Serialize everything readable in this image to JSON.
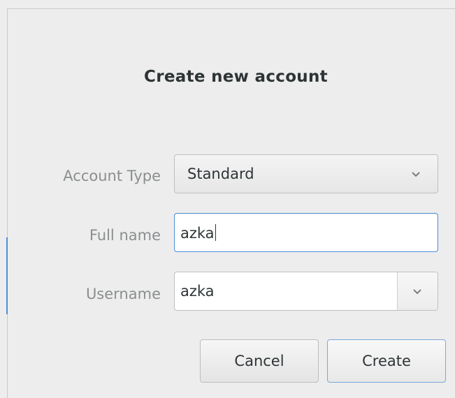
{
  "dialog": {
    "title": "Create new account"
  },
  "form": {
    "account_type": {
      "label": "Account Type",
      "selected": "Standard"
    },
    "full_name": {
      "label": "Full name",
      "value": "azka"
    },
    "username": {
      "label": "Username",
      "value": "azka"
    }
  },
  "buttons": {
    "cancel": "Cancel",
    "create": "Create"
  },
  "icons": {
    "dropdown": "chevron-down-icon"
  },
  "colors": {
    "accent": "#4a90d9",
    "label": "#8b8e8f",
    "text": "#2e3436",
    "background": "#ededed"
  }
}
